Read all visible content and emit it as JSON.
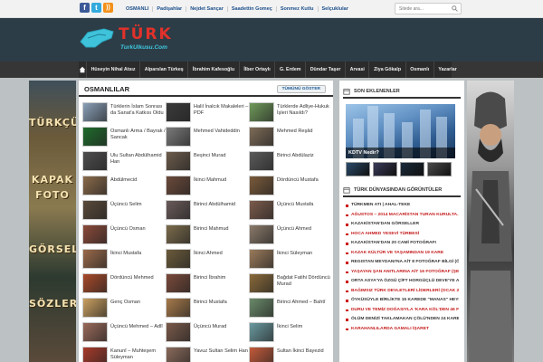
{
  "topbar": {
    "social": [
      {
        "name": "facebook-icon",
        "glyph": "f"
      },
      {
        "name": "twitter-icon",
        "glyph": "t"
      },
      {
        "name": "rss-icon",
        "glyph": "))"
      }
    ],
    "nav": [
      "OSMANLI",
      "Padişahlar",
      "Nejdet Sançar",
      "Saadettin Gomeç",
      "Sonmez Kutlu",
      "Selçuklular"
    ],
    "search_placeholder": "Sitede ara..."
  },
  "header": {
    "logo_text": "TÜRK",
    "logo_sub": "TurkUlkusu.Com"
  },
  "mainnav": [
    "Hüseyin Nihal Atsız",
    "Alparslan Türkeş",
    "İbrahim Kafesoğlu",
    "İlber Ortaylı",
    "G. Erdem",
    "Dündar Taşer",
    "Arvasi",
    "Ziya Gökalp",
    "Osmanlı",
    "Yazarlar"
  ],
  "banners": {
    "left": [
      "TÜRKÇÜ",
      "KAPAK",
      "FOTO",
      "GÖRSEL",
      "SÖZLER"
    ]
  },
  "section": {
    "title": "OSMANLILAR",
    "show_all": "TÜMÜNÜ GÖSTER",
    "items": [
      {
        "name": "Türklerin İslam Sonrası da Sanat'a Katkısı Oldu",
        "color": "#8aa0b8"
      },
      {
        "name": "Halil İnalcık Makaleleri – PDF",
        "color": "#3b3b3b"
      },
      {
        "name": "Türklerde Adliye-Hukuk İşleri Nasıldı?",
        "color": "#6f9a5a"
      },
      {
        "name": "Osmanlı Arma / Bayrak / Sancak",
        "color": "#1f6b2c"
      },
      {
        "name": "Mehmed Vahideddin",
        "color": "#7a7a7a"
      },
      {
        "name": "Mehmed Reşâd",
        "color": "#7d6b57"
      },
      {
        "name": "Ulu Sultan Abdülhamid Han",
        "color": "#4d4d4d"
      },
      {
        "name": "Beşinci Murad",
        "color": "#6b5b4b"
      },
      {
        "name": "Birinci Abdülaziz",
        "color": "#5b5b5b"
      },
      {
        "name": "Abdülmecid",
        "color": "#8a6a4a"
      },
      {
        "name": "İkinci Mahmud",
        "color": "#6b4a3a"
      },
      {
        "name": "Dördüncü Mustafa",
        "color": "#7a5a3a"
      },
      {
        "name": "Üçüncü Selim",
        "color": "#5a4a3a"
      },
      {
        "name": "Birinci Abdülhamid",
        "color": "#6a5a5a"
      },
      {
        "name": "Üçüncü Mustafa",
        "color": "#7b5b4b"
      },
      {
        "name": "Üçüncü Osman",
        "color": "#8b4a3a"
      },
      {
        "name": "Birinci Mahmud",
        "color": "#7b6b4b"
      },
      {
        "name": "Üçüncü Ahmed",
        "color": "#8a7a6a"
      },
      {
        "name": "İkinci Mustafa",
        "color": "#9a6a4a"
      },
      {
        "name": "İkinci Ahmed",
        "color": "#6b5b3b"
      },
      {
        "name": "İkinci Süleyman",
        "color": "#9b7b5b"
      },
      {
        "name": "Dördüncü Mehmed",
        "color": "#a84a2a"
      },
      {
        "name": "Birinci İbrahim",
        "color": "#7a4a3a"
      },
      {
        "name": "Bağdat Fatihi Dördüncü Murad",
        "color": "#8a6a3a"
      },
      {
        "name": "Genç Osman",
        "color": "#caa060"
      },
      {
        "name": "Birinci Mustafa",
        "color": "#a77a4a"
      },
      {
        "name": "Birinci Ahmed – Bahtî",
        "color": "#6a8a6a"
      },
      {
        "name": "Üçüncü Mehmed – Adlî",
        "color": "#9a6a5a"
      },
      {
        "name": "Üçüncü Murad",
        "color": "#7a5a4a"
      },
      {
        "name": "İkinci Selim",
        "color": "#6a9aa0"
      },
      {
        "name": "Kanunî – Muhteşem Süleyman",
        "color": "#a83a2a"
      },
      {
        "name": "Yavuz Sultan Selim Han",
        "color": "#8a6a5a"
      },
      {
        "name": "Sultan İkinci Bayezid",
        "color": "#c45a3a"
      }
    ]
  },
  "sidebar": {
    "recent_title": "SON EKLENENLER",
    "featured_caption": "KDTV Nedir?",
    "thumb_colors": [
      "#2a4a6a",
      "#3a3a5a",
      "#1a2a3a",
      "#4a4a4a"
    ],
    "list_title": "TÜRK DÜNYASINDAN GÖRÜNTÜLER",
    "list": [
      {
        "text": "TÜRKMEN ATI | AHAL-TEKE",
        "red": false
      },
      {
        "text": "AĞUSTOS – 2014 MACARİSTAN TURAN KURULTA…",
        "red": true
      },
      {
        "text": "KAZAKİSTAN'DAN GÖRSELLER",
        "red": false
      },
      {
        "text": "HOCA AHMED YESEVİ TÜRBESİ",
        "red": true
      },
      {
        "text": "KAZAKİSTAN'DAN 20 CAMİ FOTOĞRAFI",
        "red": false
      },
      {
        "text": "KAZAK KÜLTÜR VE YAŞAMINDAN 19 KARE",
        "red": true
      },
      {
        "text": "REGISTAN MEYDANI'NA AİT 8 FOTOĞRAF BİLGİ (Öz…",
        "red": false
      },
      {
        "text": "YAŞAYAN ŞAN ANITLARINA AİT 16 FOTOĞRAF (ŞE…",
        "red": true
      },
      {
        "text": "ORTA ASYA'YA ÖZGÜ ÇİFT HORGÜÇLÜ DEVE'YE Aİ…",
        "red": false
      },
      {
        "text": "BAĞIMSIZ TÜRK DEVLETLERİ LİDERLERİ (OCAK 20…",
        "red": true
      },
      {
        "text": "ÖYKÜSÜYLE BİRLİKTE 15 KAREDE \"MANAS\" HEYK…",
        "red": false
      },
      {
        "text": "DURU VE TEMİZ DOĞASIYLA 'KARA KÖL'DEN 46 FO…",
        "red": true
      },
      {
        "text": "ÖLÜM DENİZİ TAKLAMAKAN ÇÖLÜ'NDEN 24 KARE",
        "red": false
      },
      {
        "text": "KARAHANLILARDA GAMALI İŞARET",
        "red": true
      }
    ]
  }
}
